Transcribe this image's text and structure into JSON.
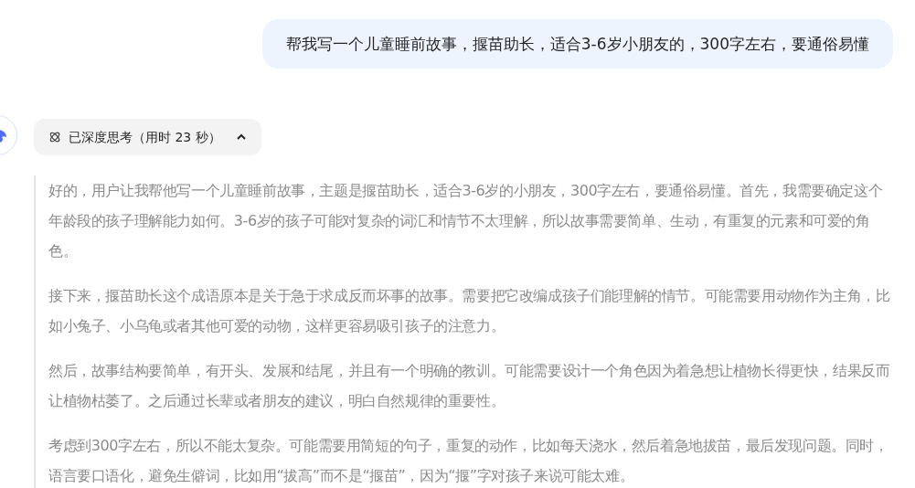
{
  "user_message": {
    "text": "帮我写一个儿童睡前故事，揠苗助长，适合3-6岁小朋友的，300字左右，要通俗易懂"
  },
  "thinking": {
    "label": "已深度思考（用时 23 秒）",
    "expanded": true,
    "paragraphs": [
      "好的，用户让我帮他写一个儿童睡前故事，主题是揠苗助长，适合3-6岁的小朋友，300字左右，要通俗易懂。首先，我需要确定这个年龄段的孩子理解能力如何。3-6岁的孩子可能对复杂的词汇和情节不太理解，所以故事需要简单、生动，有重复的元素和可爱的角色。",
      "接下来，揠苗助长这个成语原本是关于急于求成反而坏事的故事。需要把它改编成孩子们能理解的情节。可能需要用动物作为主角，比如小兔子、小乌龟或者其他可爱的动物，这样更容易吸引孩子的注意力。",
      "然后，故事结构要简单，有开头、发展和结尾，并且有一个明确的教训。可能需要设计一个角色因为着急想让植物长得更快，结果反而让植物枯萎了。之后通过长辈或者朋友的建议，明白自然规律的重要性。",
      "考虑到300字左右，所以不能太复杂。可能需要用简短的句子，重复的动作，比如每天浇水，然后着急地拔苗，最后发现问题。同时，语言要口语化，避免生僻词，比如用“拔高”而不是“揠苗”，因为“揠”字对孩子来说可能太难。"
    ]
  }
}
